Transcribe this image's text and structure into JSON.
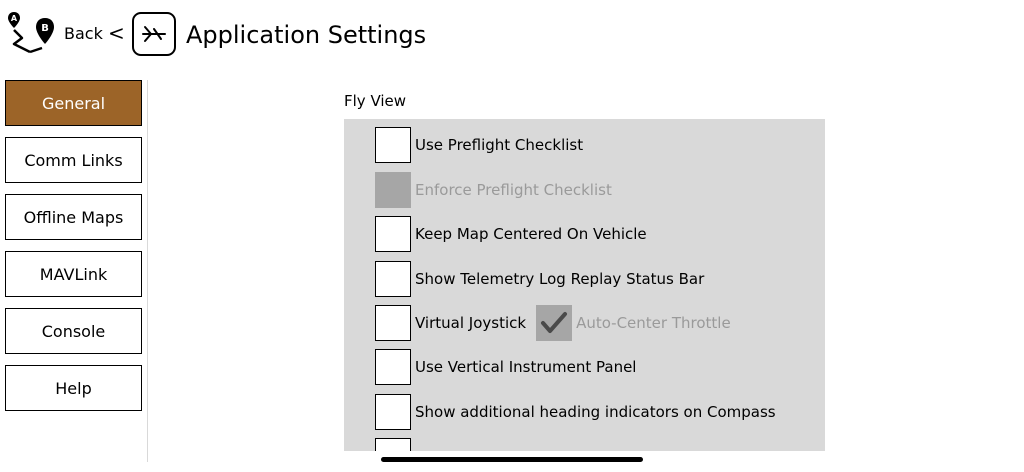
{
  "header": {
    "back_label": "Back",
    "back_chevron": "<",
    "title": "Application Settings",
    "route_icon": "route-a-to-b-icon",
    "settings_icon": "app-settings-icon"
  },
  "sidebar": {
    "items": [
      {
        "label": "General",
        "active": true
      },
      {
        "label": "Comm Links",
        "active": false
      },
      {
        "label": "Offline Maps",
        "active": false
      },
      {
        "label": "MAVLink",
        "active": false
      },
      {
        "label": "Console",
        "active": false
      },
      {
        "label": "Help",
        "active": false
      }
    ]
  },
  "main": {
    "section_title": "Fly View",
    "options": [
      {
        "label": "Use Preflight Checklist",
        "checked": false,
        "enabled": true
      },
      {
        "label": "Enforce Preflight Checklist",
        "checked": false,
        "enabled": false
      },
      {
        "label": "Keep Map Centered On Vehicle",
        "checked": false,
        "enabled": true
      },
      {
        "label": "Show Telemetry Log Replay Status Bar",
        "checked": false,
        "enabled": true
      },
      {
        "label": "Virtual Joystick",
        "checked": false,
        "enabled": true,
        "sub_option": {
          "label": "Auto-Center Throttle",
          "checked": true,
          "enabled": false
        }
      },
      {
        "label": "Use Vertical Instrument Panel",
        "checked": false,
        "enabled": true
      },
      {
        "label": "Show additional heading indicators on Compass",
        "checked": false,
        "enabled": true
      },
      {
        "label": "",
        "checked": false,
        "enabled": true
      }
    ]
  },
  "colors": {
    "active_nav": "#9c6428",
    "panel_bg": "#d9d9d9",
    "disabled_box": "#a6a6a6",
    "disabled_text": "#9a9a9a"
  }
}
